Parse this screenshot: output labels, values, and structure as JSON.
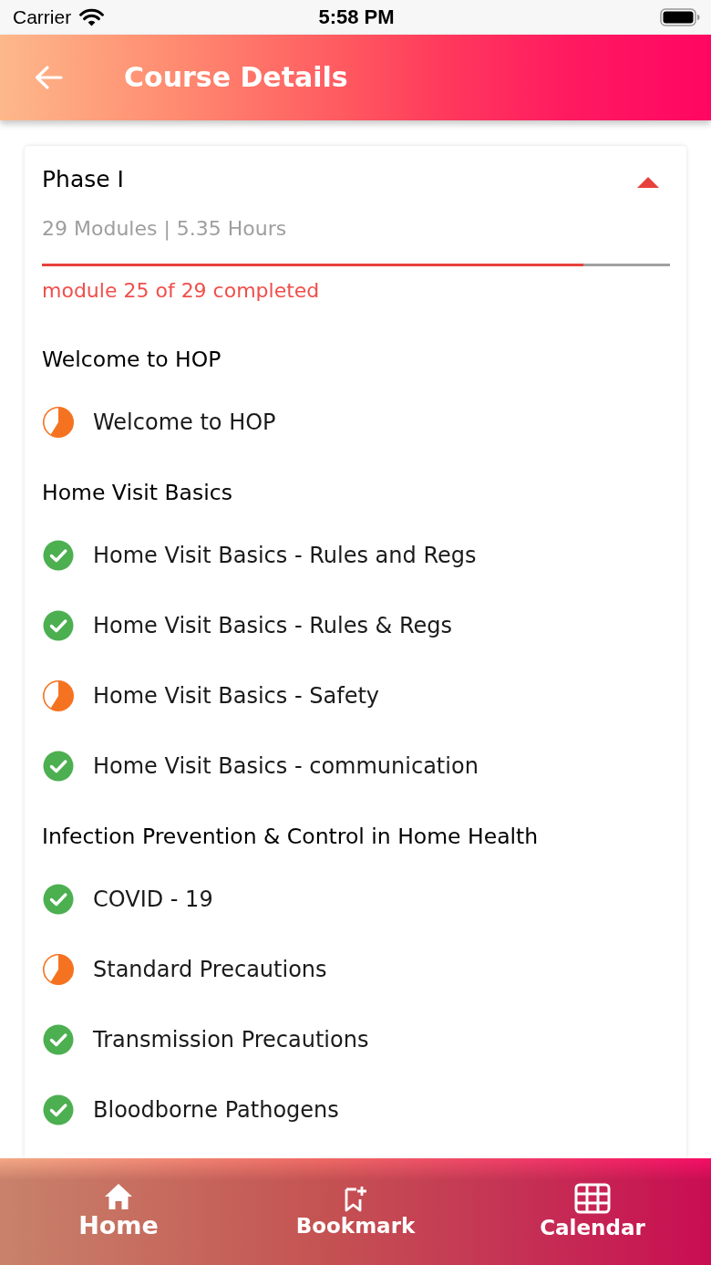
{
  "status_bar": {
    "carrier": "Carrier",
    "time": "5:58 PM"
  },
  "header": {
    "title": "Course Details"
  },
  "phase": {
    "title": "Phase I",
    "expanded": true,
    "summary": "29 Modules | 5.35 Hours",
    "progress": {
      "level": 0.862
    },
    "progress_text": "module 25 of 29 completed",
    "sections": [
      {
        "title": "Welcome to HOP",
        "modules": [
          {
            "title": "Welcome to HOP",
            "completed": false
          }
        ]
      },
      {
        "title": "Home Visit Basics",
        "modules": [
          {
            "title": "Home Visit Basics - Rules and Regs",
            "completed": true
          },
          {
            "title": "Home Visit Basics - Rules & Regs",
            "completed": true
          },
          {
            "title": "Home Visit Basics - Safety",
            "completed": false
          },
          {
            "title": "Home Visit Basics - communication",
            "completed": true
          }
        ]
      },
      {
        "title": "Infection Prevention & Control in Home Health",
        "modules": [
          {
            "title": "COVID - 19",
            "completed": true
          },
          {
            "title": "Standard Precautions",
            "completed": false
          },
          {
            "title": "Transmission Precautions",
            "completed": true
          },
          {
            "title": "Bloodborne Pathogens",
            "completed": true
          }
        ]
      }
    ]
  },
  "bottom_nav": [
    {
      "label": "Home",
      "selected": true
    },
    {
      "label": "Bookmark",
      "selected": false
    },
    {
      "label": "Calendar",
      "selected": false
    }
  ]
}
